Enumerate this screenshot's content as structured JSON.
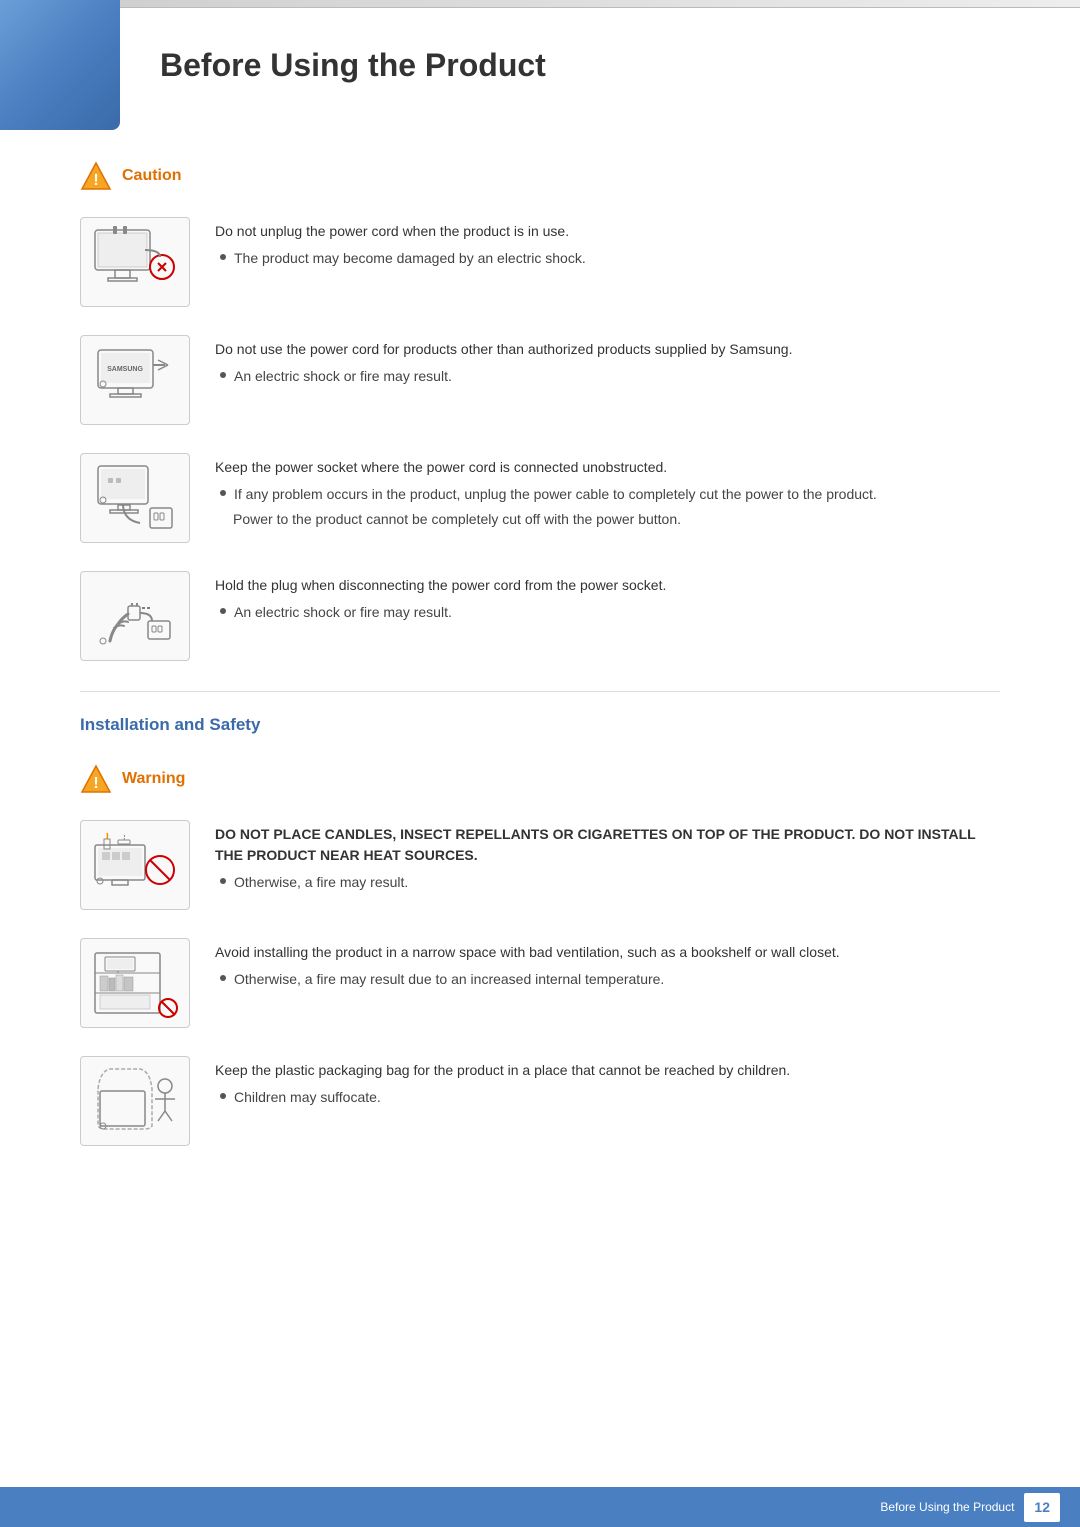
{
  "page": {
    "title": "Before Using the Product",
    "page_number": "12",
    "footer_label": "Before Using the Product"
  },
  "caution_section": {
    "heading": "Caution",
    "items": [
      {
        "id": "item1",
        "main_text": "Do not unplug the power cord when the product is in use.",
        "bullets": [
          "The product may become damaged by an electric shock."
        ],
        "sub_notes": []
      },
      {
        "id": "item2",
        "main_text": "Do not use the power cord for products other than authorized products supplied by Samsung.",
        "bullets": [
          "An electric shock or fire may result."
        ],
        "sub_notes": []
      },
      {
        "id": "item3",
        "main_text": "Keep the power socket where the power cord is connected unobstructed.",
        "bullets": [
          "If any problem occurs in the product, unplug the power cable to completely cut the power to the product."
        ],
        "sub_notes": [
          "Power to the product cannot be completely cut off with the power button."
        ]
      },
      {
        "id": "item4",
        "main_text": "Hold the plug when disconnecting the power cord from the power socket.",
        "bullets": [
          "An electric shock or fire may result."
        ],
        "sub_notes": []
      }
    ]
  },
  "installation_section": {
    "heading": "Installation and Safety",
    "warning_heading": "Warning",
    "items": [
      {
        "id": "warn1",
        "caps": true,
        "main_text": "DO NOT PLACE CANDLES, INSECT REPELLANTS OR CIGARETTES ON TOP OF THE PRODUCT. DO NOT INSTALL THE PRODUCT NEAR HEAT SOURCES.",
        "bullets": [
          "Otherwise, a fire may result."
        ],
        "sub_notes": []
      },
      {
        "id": "warn2",
        "caps": false,
        "main_text": "Avoid installing the product in a narrow space with bad ventilation, such as a bookshelf or wall closet.",
        "bullets": [
          "Otherwise, a fire may result due to an increased internal temperature."
        ],
        "sub_notes": []
      },
      {
        "id": "warn3",
        "caps": false,
        "main_text": "Keep the plastic packaging bag for the product in a place that cannot be reached by children.",
        "bullets": [
          "Children may suffocate."
        ],
        "sub_notes": []
      }
    ]
  }
}
